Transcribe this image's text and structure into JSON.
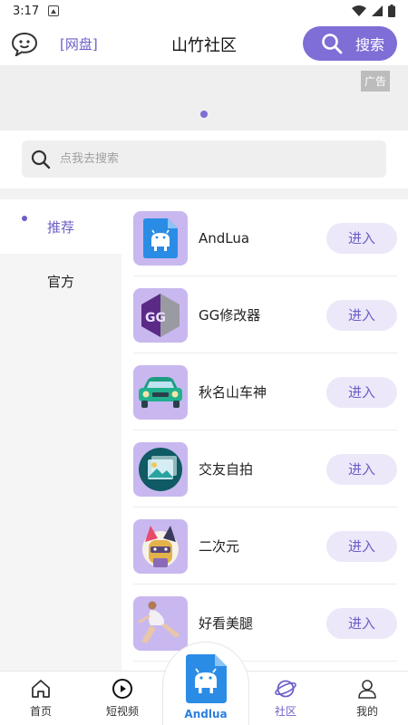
{
  "status_bar": {
    "time": "3:17"
  },
  "header": {
    "netdisk_label": "[网盘]",
    "title": "山竹社区",
    "search_label": "搜索",
    "chat_icon": "chat-bubble-icon",
    "search_icon": "search-icon"
  },
  "banner": {
    "ad_label": "广告",
    "page_indicator_count": 1
  },
  "search": {
    "placeholder": "点我去搜索"
  },
  "sidebar": {
    "items": [
      {
        "label": "推荐",
        "active": true
      },
      {
        "label": "官方",
        "active": false
      }
    ]
  },
  "apps": [
    {
      "name": "AndLua",
      "action": "进入",
      "icon": "android-file-icon"
    },
    {
      "name": "GG修改器",
      "action": "进入",
      "icon": "gg-logo-icon"
    },
    {
      "name": "秋名山车神",
      "action": "进入",
      "icon": "car-icon"
    },
    {
      "name": "交友自拍",
      "action": "进入",
      "icon": "gallery-icon"
    },
    {
      "name": "二次元",
      "action": "进入",
      "icon": "anime-character-icon"
    },
    {
      "name": "好看美腿",
      "action": "进入",
      "icon": "yoga-pose-icon"
    }
  ],
  "tabbar": {
    "items": [
      {
        "label": "首页",
        "icon": "home-icon"
      },
      {
        "label": "短视频",
        "icon": "play-circle-icon"
      },
      {
        "label": "Andlua",
        "icon": "android-file-icon"
      },
      {
        "label": "社区",
        "icon": "planet-icon",
        "active": true
      },
      {
        "label": "我的",
        "icon": "user-icon"
      }
    ]
  },
  "colors": {
    "accent": "#7f6ed6",
    "accent_text": "#6b5fc7",
    "center_tab_text": "#2a7fe0",
    "icon_tile": "#c8b8ef"
  }
}
